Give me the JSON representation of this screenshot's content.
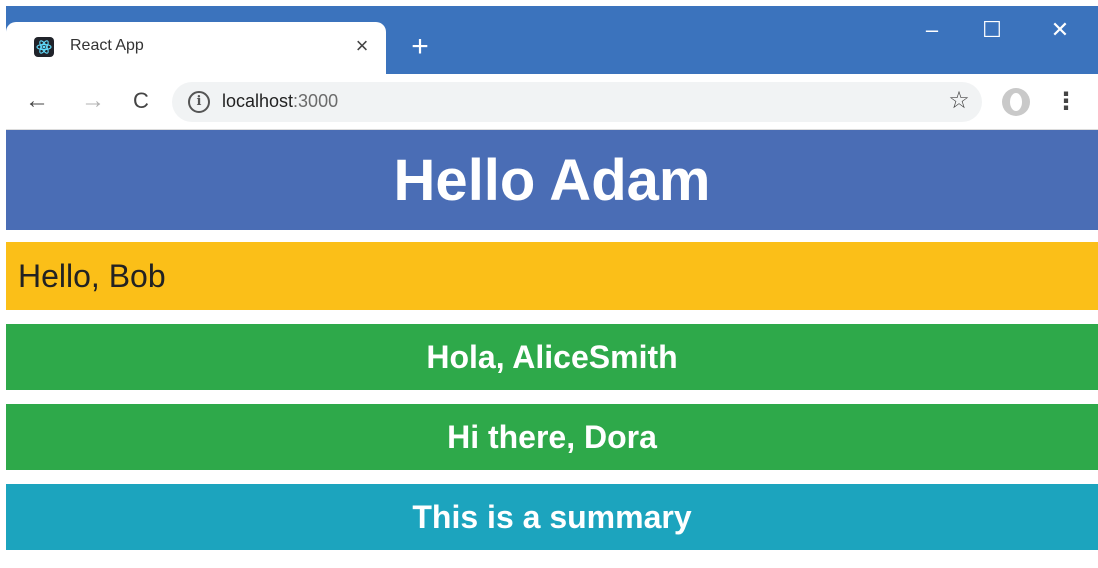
{
  "browser": {
    "tab": {
      "title": "React App",
      "favicon": "react-logo-icon",
      "close": "×"
    },
    "new_tab": "+",
    "window_controls": {
      "minimize": "–",
      "maximize": "☐",
      "close": "✕"
    },
    "toolbar": {
      "back": "←",
      "forward": "→",
      "reload": "C",
      "info": "i",
      "url_host": "localhost",
      "url_port": ":3000",
      "star": "☆",
      "menu": "⋮"
    }
  },
  "page": {
    "header": "Hello Adam",
    "message_bob": "Hello, Bob",
    "message_alice": "Hola, AliceSmith",
    "message_dora": "Hi there, Dora",
    "summary": "This is a summary"
  },
  "colors": {
    "tabstrip": "#3b73bd",
    "header_band": "#4a6db5",
    "bob_band": "#fbbf18",
    "green_band": "#2ea94a",
    "summary_band": "#1ca4be"
  }
}
